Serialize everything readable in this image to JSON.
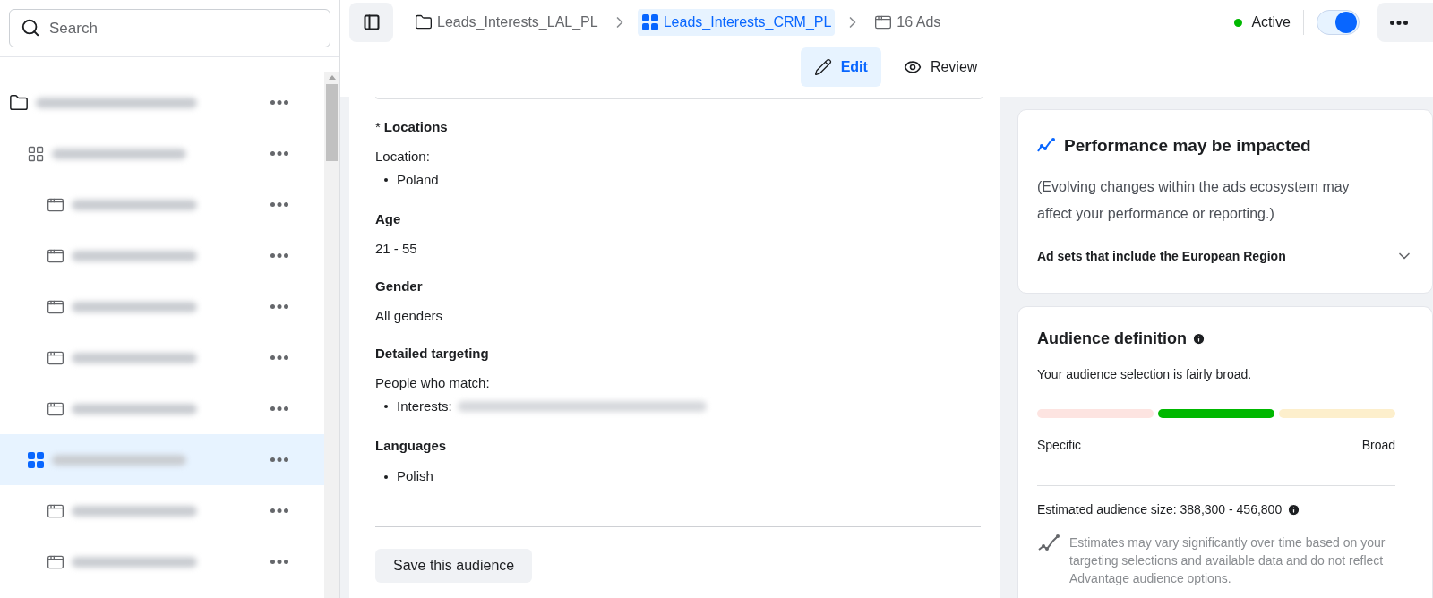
{
  "sidebar": {
    "search": {
      "placeholder": "Search"
    },
    "tree": [
      {
        "kind": "campaign",
        "selected": false,
        "children": [
          {
            "kind": "adset",
            "selected": false,
            "children": [
              {
                "kind": "ad",
                "selected": false
              },
              {
                "kind": "ad",
                "selected": false
              },
              {
                "kind": "ad",
                "selected": false
              },
              {
                "kind": "ad",
                "selected": false
              },
              {
                "kind": "ad",
                "selected": false
              }
            ]
          },
          {
            "kind": "adset",
            "selected": true,
            "children": [
              {
                "kind": "ad",
                "selected": false
              },
              {
                "kind": "ad",
                "selected": false
              }
            ]
          }
        ]
      }
    ]
  },
  "header": {
    "breadcrumbs": [
      {
        "kind": "campaign",
        "label": "Leads_Interests_LAL_PL",
        "selected": false
      },
      {
        "kind": "adset",
        "label": "Leads_Interests_CRM_PL",
        "selected": true
      },
      {
        "kind": "ad",
        "label": "16 Ads",
        "selected": false
      }
    ],
    "status": {
      "label": "Active",
      "color": "#00b800"
    },
    "toggle": {
      "on": true
    },
    "modes": [
      {
        "kind": "edit",
        "label": "Edit",
        "selected": true
      },
      {
        "kind": "review",
        "label": "Review",
        "selected": false
      }
    ]
  },
  "audience": {
    "sections": [
      {
        "title": "Locations",
        "marker": "*",
        "intro": "Location:",
        "items": [
          {
            "text": "Poland",
            "redacted": false
          }
        ]
      },
      {
        "title": "Age",
        "value": "21 - 55"
      },
      {
        "title": "Gender",
        "value": "All genders"
      },
      {
        "title": "Detailed targeting",
        "intro": "People who match:",
        "items": [
          {
            "text": "Interests:",
            "redacted": true
          }
        ]
      },
      {
        "title": "Languages",
        "items": [
          {
            "text": "Polish",
            "redacted": false
          }
        ]
      }
    ],
    "save_button": "Save this audience"
  },
  "notice": {
    "title": "Performance may be impacted",
    "body": "(Evolving changes within the ads ecosystem may affect your performance or reporting.)",
    "accordion": {
      "label": "Ad sets that include the European Region",
      "expanded": false
    }
  },
  "definition": {
    "title": "Audience definition",
    "summary": "Your audience selection is fairly broad.",
    "segments": [
      {
        "color": "#fde4e1"
      },
      {
        "color": "#00b800"
      },
      {
        "color": "#fdefcc"
      }
    ],
    "low_label": "Specific",
    "high_label": "Broad",
    "estimate": "Estimated audience size: 388,300 - 456,800",
    "disclaimer": "Estimates may vary significantly over time based on your targeting selections and available data and do not reflect Advantage audience options."
  }
}
